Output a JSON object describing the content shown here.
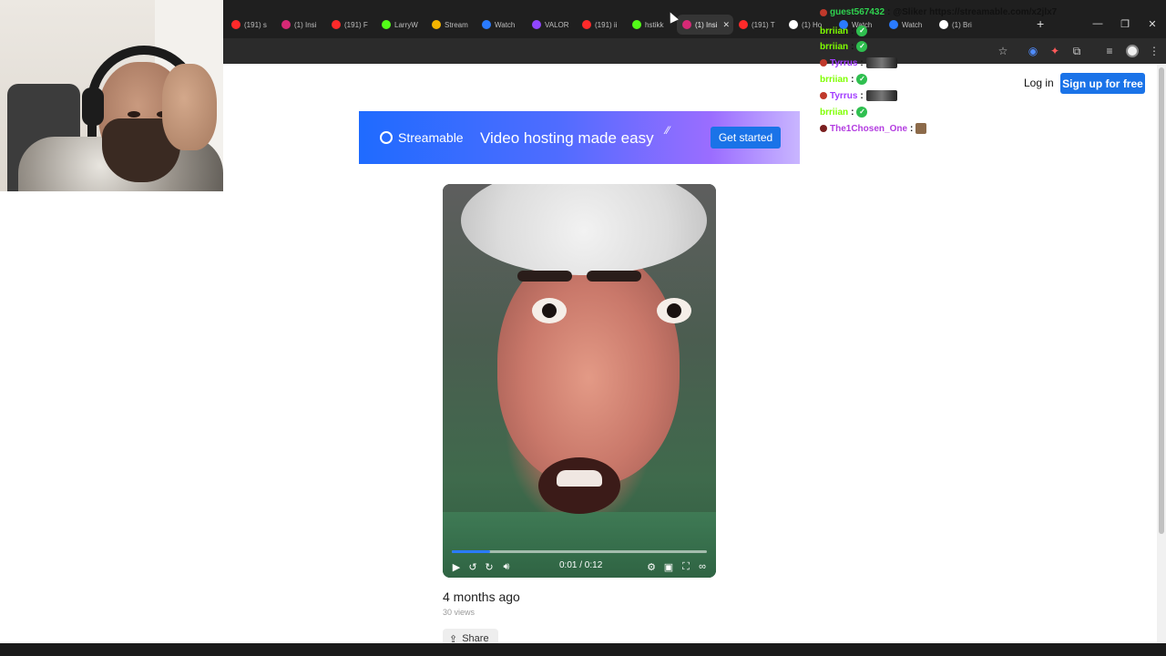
{
  "browser": {
    "tabs": [
      {
        "label": "(191) s",
        "favicon": "youtube-icon",
        "color": "#ff2a2a"
      },
      {
        "label": "(1) Insi",
        "favicon": "instagram-icon",
        "color": "#d62976"
      },
      {
        "label": "(191) F",
        "favicon": "youtube-icon",
        "color": "#ff2a2a"
      },
      {
        "label": "LarryW",
        "favicon": "kick-icon",
        "color": "#53fc18"
      },
      {
        "label": "Stream",
        "favicon": "chart-icon",
        "color": "#f4b400"
      },
      {
        "label": "Watch",
        "favicon": "streamable-icon",
        "color": "#2a7bff"
      },
      {
        "label": "VALOR",
        "favicon": "twitch-icon",
        "color": "#9146ff"
      },
      {
        "label": "(191) ii",
        "favicon": "youtube-icon",
        "color": "#ff2a2a"
      },
      {
        "label": "hstikk",
        "favicon": "kick-icon",
        "color": "#53fc18"
      },
      {
        "label": "(1) Insi",
        "favicon": "instagram-icon",
        "color": "#d62976",
        "active": true
      },
      {
        "label": "(191) T",
        "favicon": "youtube-icon",
        "color": "#ff2a2a"
      },
      {
        "label": "(1) Ho",
        "favicon": "x-icon",
        "color": "#ffffff"
      },
      {
        "label": "Watch",
        "favicon": "streamable-icon",
        "color": "#2a7bff"
      },
      {
        "label": "Watch",
        "favicon": "streamable-icon",
        "color": "#2a7bff"
      },
      {
        "label": "(1) Bri",
        "favicon": "x-icon",
        "color": "#ffffff"
      }
    ],
    "window_buttons": [
      "—",
      "❐",
      "✕"
    ]
  },
  "header": {
    "login_label": "Log in",
    "signup_label": "Sign up for free"
  },
  "banner": {
    "brand": "Streamable",
    "tagline": "Video hosting made easy",
    "cta_label": "Get started"
  },
  "player": {
    "timecode": "0:01 / 0:12",
    "progress_fraction": 0.15,
    "accent": "#2a7bff"
  },
  "video_meta": {
    "posted": "4 months ago",
    "views": "30 views",
    "share_label": "Share"
  },
  "chat": [
    {
      "user": "guest567432",
      "color": "#2fd24f",
      "badge": "#c0392b",
      "message": "@Sliker https://streamable.com/x2jlx7",
      "emote": null
    },
    {
      "user": "brriian",
      "color": "#7fff00",
      "badge": null,
      "message": "",
      "emote": "check"
    },
    {
      "user": "brriian",
      "color": "#7fff00",
      "badge": null,
      "message": "",
      "emote": "check"
    },
    {
      "user": "Tyrrus",
      "color": "#a23cff",
      "badge": "#c0392b",
      "message": "",
      "emote": "image"
    },
    {
      "user": "brriian",
      "color": "#7fff00",
      "badge": null,
      "message": "",
      "emote": "check"
    },
    {
      "user": "Tyrrus",
      "color": "#a23cff",
      "badge": "#c0392b",
      "message": "",
      "emote": "image"
    },
    {
      "user": "brriian",
      "color": "#7fff00",
      "badge": null,
      "message": "",
      "emote": "check"
    },
    {
      "user": "The1Chosen_One",
      "color": "#b33ce0",
      "badge": "#7a1f1f",
      "message": "",
      "emote": "face"
    }
  ]
}
